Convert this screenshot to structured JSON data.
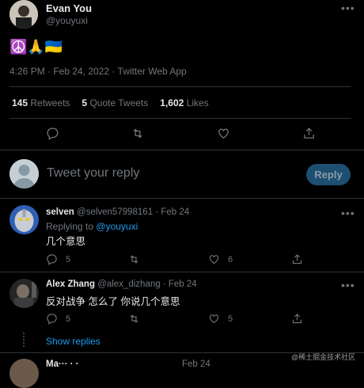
{
  "tweet": {
    "author_name": "Evan You",
    "author_handle": "@youyuxi",
    "emoji": "☮️🙏🇺🇦",
    "meta": "4:26 PM · Feb 24, 2022 · Twitter Web App",
    "stats": {
      "retweets_count": "145",
      "retweets_label": "Retweets",
      "quotes_count": "5",
      "quotes_label": "Quote Tweets",
      "likes_count": "1,602",
      "likes_label": "Likes"
    }
  },
  "composer": {
    "placeholder": "Tweet your reply",
    "button": "Reply"
  },
  "replies": [
    {
      "name": "selven",
      "handle": "@selven57998161",
      "dot": "·",
      "date": "Feb 24",
      "replying_to_label": "Replying to",
      "replying_to_handle": "@youyuxi",
      "text": "几个意思",
      "reply_count": "5",
      "like_count": "6"
    },
    {
      "name": "Alex Zhang",
      "handle": "@alex_dizhang",
      "dot": "·",
      "date": "Feb 24",
      "text": "反对战争 怎么了 你说几个意思",
      "reply_count": "5",
      "like_count": "5"
    }
  ],
  "show_replies": "Show replies",
  "next_reply_partial": {
    "name": "Ma··· · ·",
    "date": "Feb 24"
  },
  "watermark": "@稀土掘金技术社区",
  "colors": {
    "accent": "#1d9bf0",
    "background": "#000000",
    "muted": "#71767b",
    "divider": "#2f3336"
  }
}
